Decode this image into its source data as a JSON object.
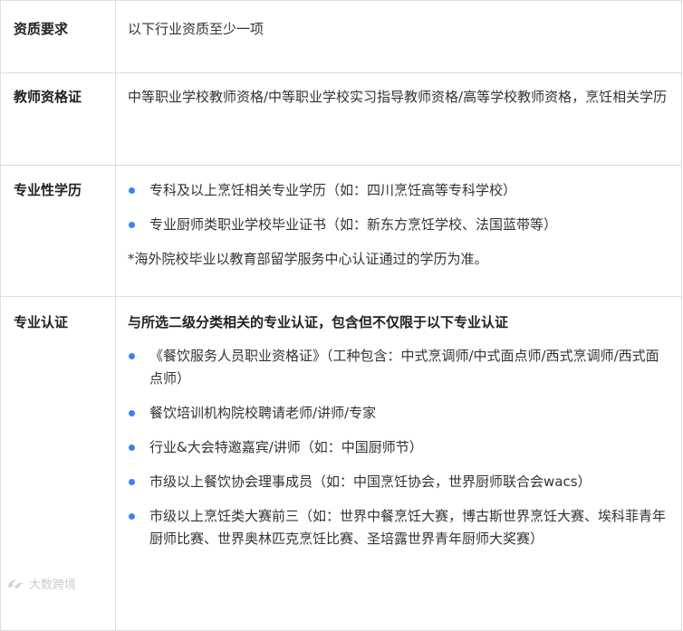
{
  "rows": {
    "head": {
      "label": "资质要求",
      "content": "以下行业资质至少一项"
    },
    "teacher": {
      "label": "教师资格证",
      "content": "中等职业学校教师资格/中等职业学校实习指导教师资格/高等学校教师资格，烹饪相关学历"
    },
    "degree": {
      "label": "专业性学历",
      "items": [
        "专科及以上烹饪相关专业学历（如：四川烹饪高等专科学校）",
        "专业厨师类职业学校毕业证书（如：新东方烹饪学校、法国蓝带等）"
      ],
      "note": "*海外院校毕业以教育部留学服务中心认证通过的学历为准。"
    },
    "cert": {
      "label": "专业认证",
      "intro": "与所选二级分类相关的专业认证，包含但不仅限于以下专业认证",
      "items": [
        "《餐饮服务人员职业资格证》（工种包含：中式烹调师/中式面点师/西式烹调师/西式面点师）",
        "餐饮培训机构院校聘请老师/讲师/专家",
        "行业&大会特邀嘉宾/讲师（如：中国厨师节）",
        "市级以上餐饮协会理事成员（如：中国烹饪协会，世界厨师联合会wacs）",
        "市级以上烹饪类大赛前三（如：世界中餐烹饪大赛，博古斯世界烹饪大赛、埃科菲青年厨师比赛、世界奥林匹克烹饪比赛、圣培露世界青年厨师大奖赛）"
      ]
    }
  },
  "watermark": {
    "text": "大数跨境"
  },
  "colors": {
    "bullet": "#3b82f6",
    "border": "#dedede",
    "text": "#333333"
  }
}
